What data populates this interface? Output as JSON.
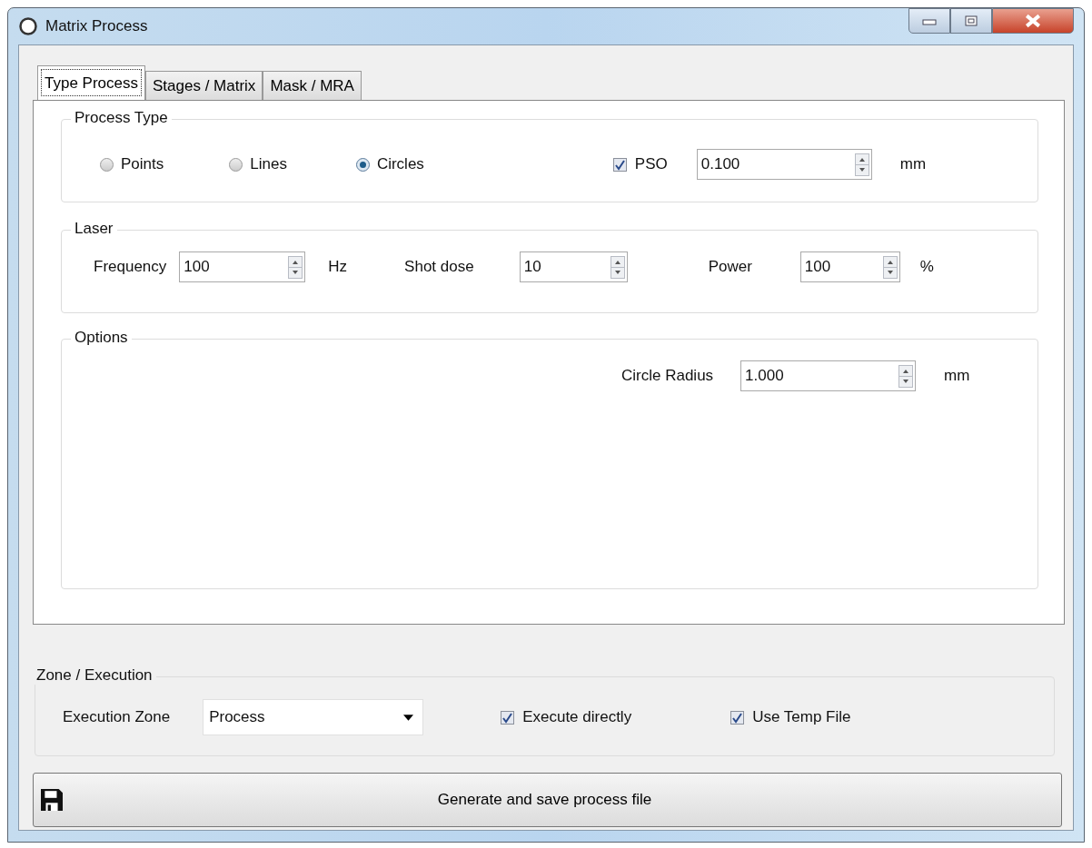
{
  "window": {
    "title": "Matrix Process"
  },
  "tabs": [
    {
      "label": "Type Process",
      "selected": true
    },
    {
      "label": "Stages / Matrix",
      "selected": false
    },
    {
      "label": "Mask / MRA",
      "selected": false
    }
  ],
  "process_type": {
    "title": "Process Type",
    "options": [
      {
        "label": "Points",
        "selected": false
      },
      {
        "label": "Lines",
        "selected": false
      },
      {
        "label": "Circles",
        "selected": true
      }
    ],
    "pso": {
      "label": "PSO",
      "checked": true,
      "value": "0.100",
      "unit": "mm"
    }
  },
  "laser": {
    "title": "Laser",
    "fields": [
      {
        "label": "Frequency",
        "value": "100",
        "unit": "Hz"
      },
      {
        "label": "Shot dose",
        "value": "10"
      },
      {
        "label": "Power",
        "value": "100",
        "unit": "%"
      }
    ]
  },
  "options": {
    "title": "Options",
    "circle_radius": {
      "label": "Circle Radius",
      "value": "1.000",
      "unit": "mm"
    }
  },
  "zone": {
    "title": "Zone / Execution",
    "label": "Execution Zone",
    "value": "Process",
    "checks": [
      {
        "label": "Execute directly",
        "checked": true
      },
      {
        "label": "Use Temp File",
        "checked": true
      }
    ]
  },
  "button": {
    "label": "Generate and save process file"
  }
}
